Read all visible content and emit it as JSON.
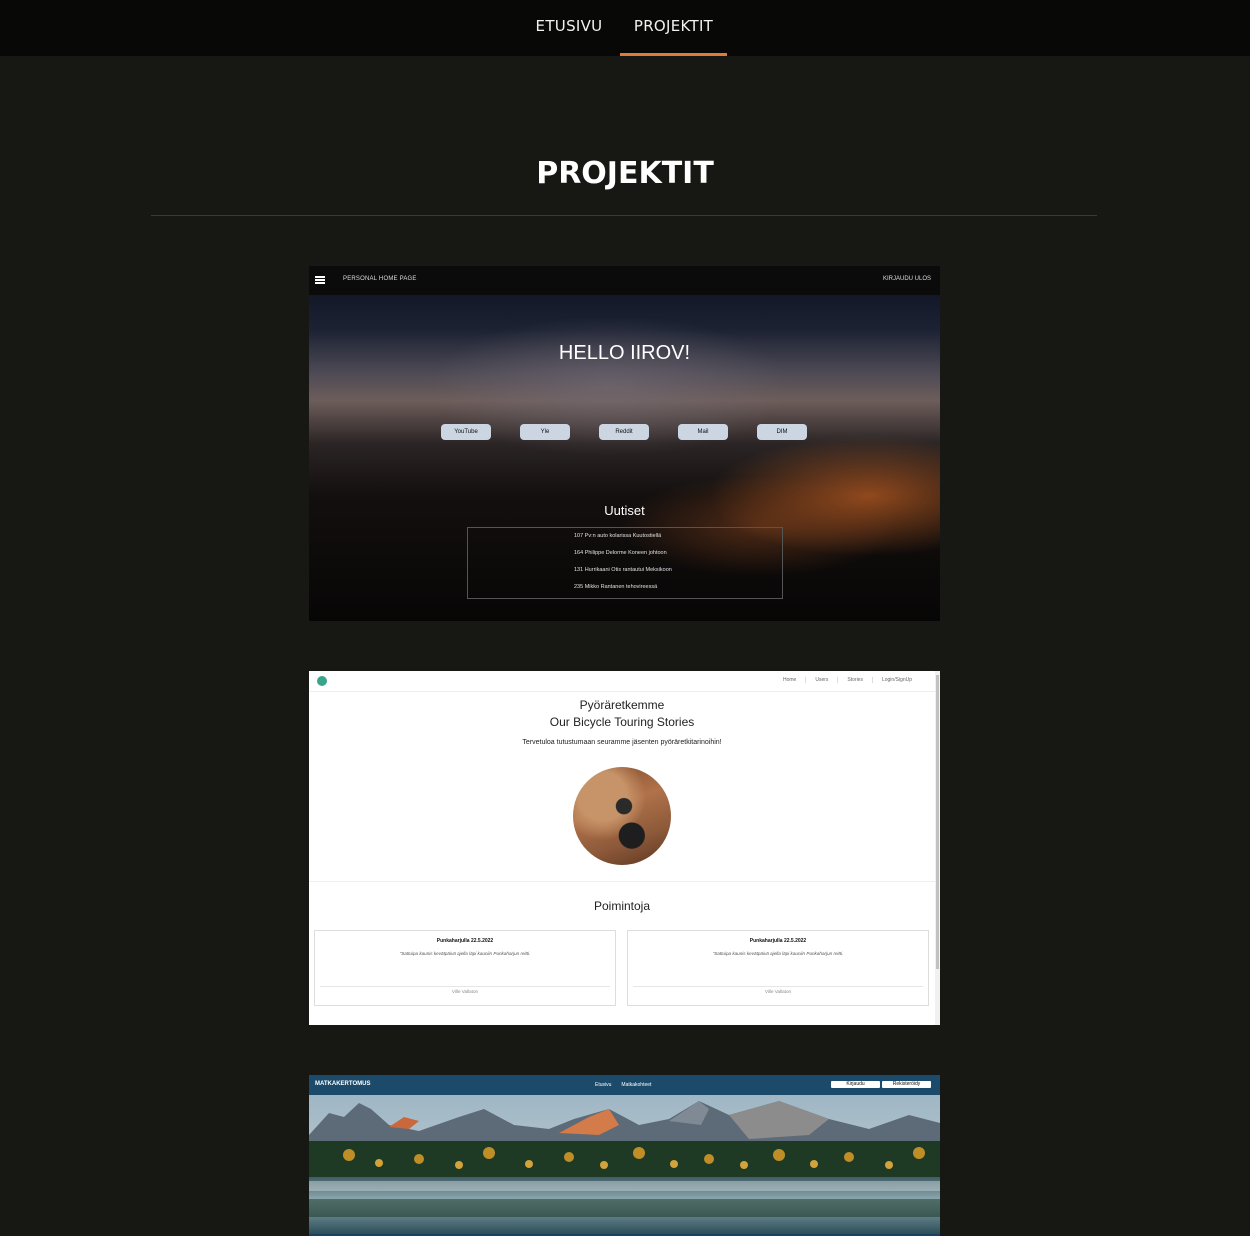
{
  "nav": {
    "items": [
      "ETUSIVU",
      "PROJEKTIT"
    ],
    "active": "PROJEKTIT",
    "accent": "#e07b3a"
  },
  "page": {
    "title": "PROJEKTIT"
  },
  "projects": {
    "p1": {
      "brand": "PERSONAL HOME PAGE",
      "logout": "KIRJAUDU ULOS",
      "greeting": "HELLO IIROV!",
      "links": [
        "YouTube",
        "Yle",
        "Reddit",
        "Mail",
        "DIM"
      ],
      "news_title": "Uutiset",
      "news": [
        "107 Pv:n auto kolarissa Kuutostiellä",
        "164 Philippe Delorme Koneen johtoon",
        "131 Hurrikaani Otis rantautui Meksikoon",
        "235 Mikko Rantanen tehovireessä"
      ]
    },
    "p2": {
      "nav": [
        "Home",
        "Users",
        "Stories",
        "Login/SignUp"
      ],
      "title_fi": "Pyöräretkemme",
      "title_en": "Our Bicycle Touring Stories",
      "subtitle": "Tervetuloa tutustumaan seuramme jäsenten pyöräretkitarinoihin!",
      "section": "Poimintoja",
      "cards": [
        {
          "title": "Punkaharjulla 22.5.2022",
          "quote": "\"Sattuipa kaunis kevätpäivä ajella läpi kauniin Punkaharjun reitti.",
          "author": "Ville Vallaton"
        },
        {
          "title": "Punkaharjulla 22.5.2022",
          "quote": "\"Sattuipa kaunis kevätpäivä ajella läpi kauniin Punkaharjun reitti.",
          "author": "Ville Vallaton"
        }
      ]
    },
    "p3": {
      "brand": "MATKAKERTOMUS",
      "nav": [
        "Etusivu",
        "Matkakohteet"
      ],
      "buttons": [
        "Kirjaudu",
        "Rekisteröidy"
      ]
    }
  }
}
